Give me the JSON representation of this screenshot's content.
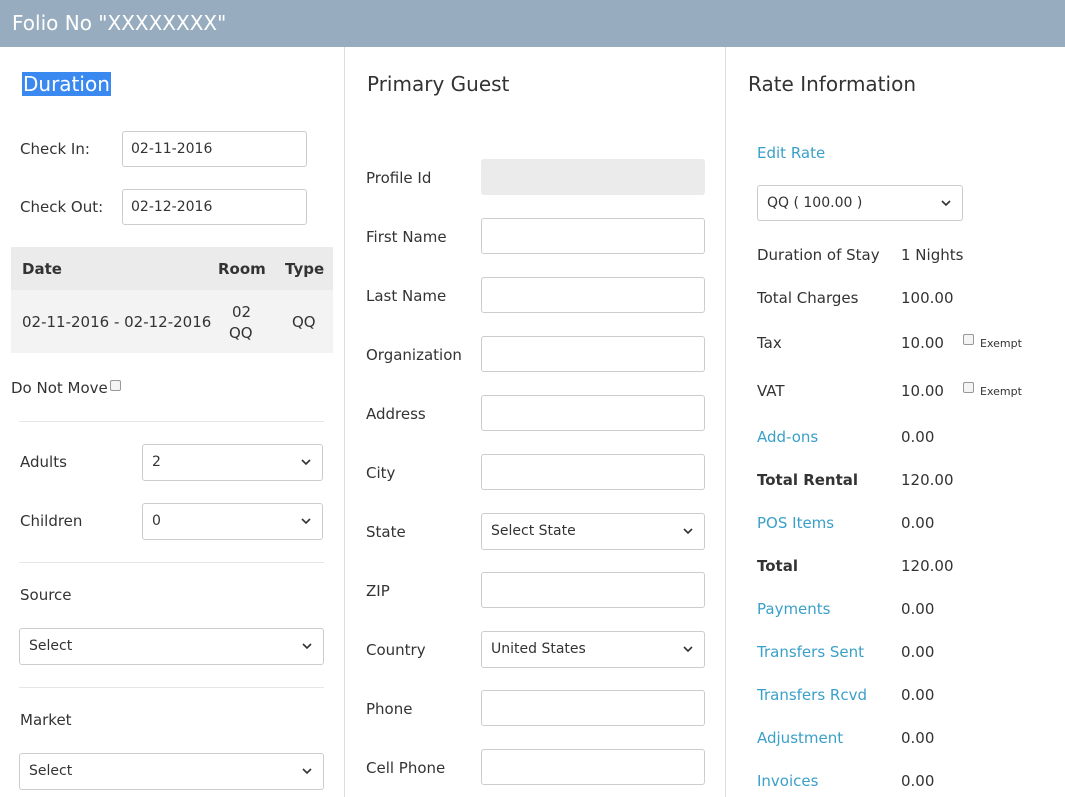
{
  "header": {
    "title": "Folio No \"XXXXXXXX\""
  },
  "duration": {
    "title": "Duration",
    "check_in_label": "Check In:",
    "check_in_value": "02-11-2016",
    "check_out_label": "Check Out:",
    "check_out_value": "02-12-2016",
    "table": {
      "headers": [
        "Date",
        "Room",
        "Type"
      ],
      "rows": [
        {
          "date": "02-11-2016 - 02-12-2016",
          "room_number": "02",
          "room_type": "QQ",
          "type": "QQ"
        }
      ]
    },
    "do_not_move_label": "Do Not Move",
    "adults_label": "Adults",
    "adults_value": "2",
    "children_label": "Children",
    "children_value": "0",
    "source_label": "Source",
    "source_value": "Select",
    "market_label": "Market",
    "market_value": "Select"
  },
  "guest": {
    "title": "Primary Guest",
    "fields": [
      {
        "label": "Profile Id",
        "value": ""
      },
      {
        "label": "First Name",
        "value": ""
      },
      {
        "label": "Last Name",
        "value": ""
      },
      {
        "label": "Organization",
        "value": ""
      },
      {
        "label": "Address",
        "value": ""
      },
      {
        "label": "City",
        "value": ""
      },
      {
        "label": "State",
        "value": "Select State"
      },
      {
        "label": "ZIP",
        "value": ""
      },
      {
        "label": "Country",
        "value": "United States"
      },
      {
        "label": "Phone",
        "value": ""
      },
      {
        "label": "Cell Phone",
        "value": ""
      }
    ]
  },
  "rate": {
    "title": "Rate Information",
    "edit_rate": "Edit Rate",
    "rate_select": "QQ ( 100.00 )",
    "rows": [
      {
        "label": "Duration of Stay",
        "value": "1 Nights"
      },
      {
        "label": "Total Charges",
        "value": "100.00"
      },
      {
        "label": "Tax",
        "value": "10.00",
        "exempt": "Exempt"
      },
      {
        "label": "VAT",
        "value": "10.00",
        "exempt": "Exempt"
      },
      {
        "label": "Add-ons",
        "value": "0.00"
      },
      {
        "label": "Total Rental",
        "value": "120.00"
      },
      {
        "label": "POS Items",
        "value": "0.00"
      },
      {
        "label": "Total",
        "value": "120.00"
      },
      {
        "label": "Payments",
        "value": "0.00"
      },
      {
        "label": "Transfers Sent",
        "value": "0.00"
      },
      {
        "label": "Transfers Rcvd",
        "value": "0.00"
      },
      {
        "label": "Adjustment",
        "value": "0.00"
      },
      {
        "label": "Invoices",
        "value": "0.00"
      }
    ]
  },
  "colors": {
    "header_bg": "#97adbf",
    "link": "#3aa0c8",
    "highlight": "#3a89f0"
  }
}
